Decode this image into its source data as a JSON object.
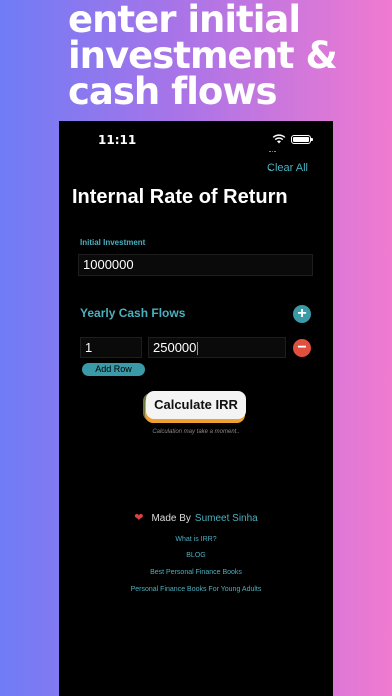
{
  "headline": {
    "line1": "enter initial",
    "line2": "investment &",
    "line3": "cash flows"
  },
  "status_bar": {
    "time": "11:11"
  },
  "header": {
    "clear_label": "Clear All",
    "title": "Internal Rate of Return"
  },
  "initial": {
    "label": "Initial Investment",
    "value": "1000000"
  },
  "cash_flows": {
    "label": "Yearly Cash Flows",
    "add_icon": "+",
    "remove_icon": "−",
    "rows": [
      {
        "year": "1",
        "amount": "250000"
      }
    ],
    "add_row_label": "Add Row"
  },
  "calculate": {
    "label": "Calculate IRR",
    "note": "Calculation may take a moment.."
  },
  "footer": {
    "heart": "❤",
    "made_by": "Made By",
    "author": "Sumeet Sinha",
    "links": [
      "What is IRR?",
      "BLOG",
      "Best Personal Finance Books",
      "Personal Finance Books For Young Adults"
    ]
  },
  "colors": {
    "accent": "#4bb0bf",
    "danger": "#e0503f",
    "background": "#000000"
  }
}
